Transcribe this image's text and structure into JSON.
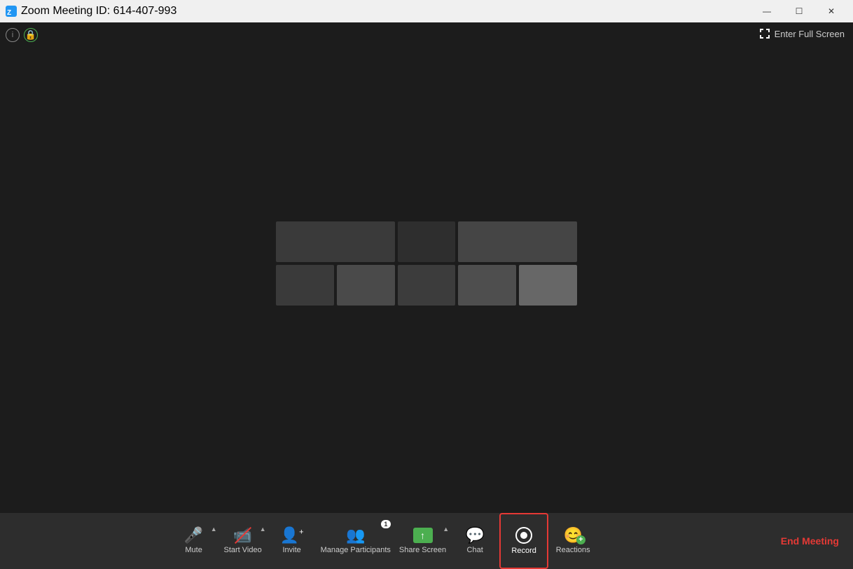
{
  "titleBar": {
    "title": "Zoom Meeting ID: 614-407-993",
    "logoAlt": "Zoom logo",
    "controls": {
      "minimize": "—",
      "maximize": "☐",
      "close": "✕"
    }
  },
  "topIcons": {
    "info": "i",
    "lock": "🔒"
  },
  "fullscreen": {
    "label": "Enter Full Screen"
  },
  "blurCells": [
    {
      "color": "#3a3a3a"
    },
    {
      "color": "#3f3f3f"
    },
    {
      "color": "#2e2e2e"
    },
    {
      "color": "#4a4a4a"
    },
    {
      "color": "#3c3c3c"
    },
    {
      "color": "#3a3a3a"
    },
    {
      "color": "#454545"
    },
    {
      "color": "#393939"
    },
    {
      "color": "#4e4e4e"
    },
    {
      "color": "#606060"
    }
  ],
  "toolbar": {
    "mute": {
      "label": "Mute",
      "icon": "🎤"
    },
    "startVideo": {
      "label": "Start Video",
      "icon": "📹"
    },
    "invite": {
      "label": "Invite",
      "icon": "👤+"
    },
    "manageParticipants": {
      "label": "Manage Participants",
      "badge": "1"
    },
    "shareScreen": {
      "label": "Share Screen"
    },
    "chat": {
      "label": "Chat"
    },
    "record": {
      "label": "Record"
    },
    "reactions": {
      "label": "Reactions"
    },
    "endMeeting": {
      "label": "End Meeting"
    }
  }
}
